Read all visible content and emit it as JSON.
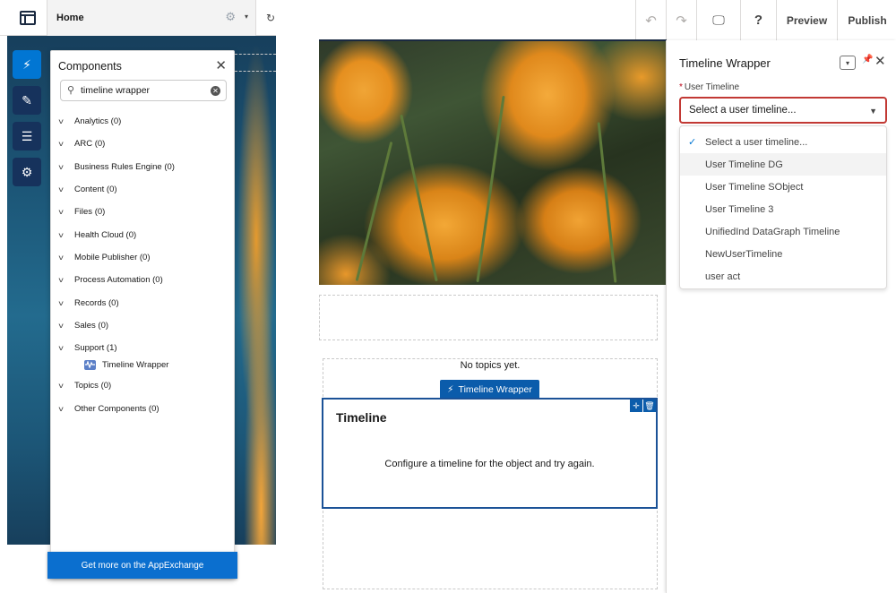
{
  "left_header": {
    "page_name": "Home",
    "gear_glyph": "⚙",
    "caret_glyph": "▾",
    "refresh_glyph": "↻"
  },
  "rail": {
    "items": [
      {
        "name": "components-rail-button",
        "icon": "bolt-icon",
        "glyph": "⚡"
      },
      {
        "name": "theme-rail-button",
        "icon": "brush-icon",
        "glyph": "✎"
      },
      {
        "name": "page-structure-rail-button",
        "icon": "list-icon",
        "glyph": "☰"
      },
      {
        "name": "settings-rail-button",
        "icon": "gear-icon",
        "glyph": "⚙"
      }
    ]
  },
  "components_panel": {
    "title": "Components",
    "close_glyph": "✕",
    "search": {
      "value": "timeline wrapper",
      "placeholder": "",
      "icon_glyph": "⚲",
      "clear_glyph": "✕"
    },
    "chevron_glyph": "v",
    "categories": [
      {
        "label": "Analytics (0)"
      },
      {
        "label": "ARC (0)"
      },
      {
        "label": "Business Rules Engine (0)"
      },
      {
        "label": "Content (0)"
      },
      {
        "label": "Files (0)"
      },
      {
        "label": "Health Cloud (0)"
      },
      {
        "label": "Mobile Publisher (0)"
      },
      {
        "label": "Process Automation (0)"
      },
      {
        "label": "Records (0)"
      },
      {
        "label": "Sales (0)"
      },
      {
        "label": "Support (1)",
        "children": [
          {
            "label": "Timeline Wrapper",
            "icon": "timeline-icon"
          }
        ]
      },
      {
        "label": "Topics (0)"
      },
      {
        "label": "Other Components (0)"
      }
    ],
    "footer": "Get more on the AppExchange"
  },
  "right_header": {
    "undo_glyph": "↶",
    "redo_glyph": "↷",
    "device_glyph": "🖵",
    "help_glyph": "?",
    "preview_label": "Preview",
    "publish_label": "Publish"
  },
  "canvas": {
    "no_topics": "No topics yet.",
    "component_tag": "Timeline Wrapper",
    "component_tag_glyph": "⚡",
    "card_title": "Timeline",
    "card_message": "Configure a timeline for the object and try again.",
    "move_glyph": "✛",
    "delete_glyph": "🗑"
  },
  "property_panel": {
    "title": "Timeline Wrapper",
    "menu_glyph": "▾",
    "pin_glyph": "📌",
    "close_glyph": "✕",
    "field_label": "User Timeline",
    "required_marker": "*",
    "combobox_value": "Select a user timeline...",
    "combobox_caret": "▼",
    "check_glyph": "✓",
    "options": [
      {
        "label": "Select a user timeline...",
        "selected": true
      },
      {
        "label": "User Timeline DG",
        "hover": true
      },
      {
        "label": "User Timeline SObject"
      },
      {
        "label": "User Timeline 3"
      },
      {
        "label": "UnifiedInd DataGraph Timeline"
      },
      {
        "label": "NewUserTimeline"
      },
      {
        "label": "user act"
      }
    ]
  },
  "colors": {
    "brand_blue": "#0176d3",
    "dark_navy": "#16325c",
    "component_blue": "#0b5cab",
    "error_red": "#c23934"
  }
}
